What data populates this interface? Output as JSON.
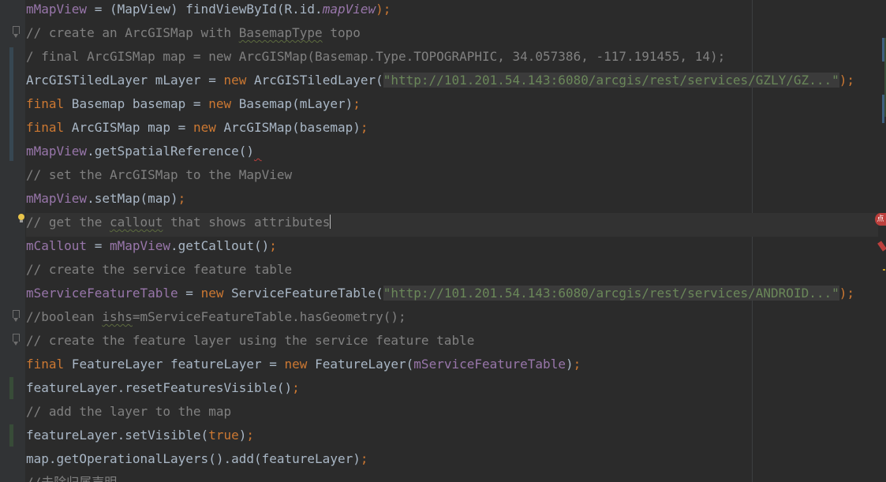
{
  "editor": {
    "lines": [
      {
        "tokens": [
          {
            "t": "mMapView",
            "c": "field"
          },
          {
            "t": " = (MapView) findViewById(R.id.",
            "c": "plain"
          },
          {
            "t": "mapView",
            "c": "italic"
          },
          {
            "t": ");",
            "c": "kw"
          }
        ]
      },
      {
        "tokens": [
          {
            "t": "// create an ArcGISMap with ",
            "c": "comment"
          },
          {
            "t": "BasemapType",
            "c": "comment squig"
          },
          {
            "t": " topo",
            "c": "comment"
          }
        ]
      },
      {
        "tokens": [
          {
            "t": "/ final ArcGISMap map = new ArcGISMap(Basemap.Type.TOPOGRAPHIC, 34.057386, -117.191455, 14);",
            "c": "comment"
          }
        ]
      },
      {
        "tokens": [
          {
            "t": "ArcGISTiledLayer mLayer = ",
            "c": "plain"
          },
          {
            "t": "new",
            "c": "kw"
          },
          {
            "t": " ArcGISTiledLayer(",
            "c": "plain"
          },
          {
            "t": "\"http://101.201.54.143:6080/arcgis/rest/services/GZLY/GZ...\"",
            "c": "fold"
          },
          {
            "t": ");",
            "c": "kw"
          }
        ]
      },
      {
        "tokens": [
          {
            "t": "final",
            "c": "kw"
          },
          {
            "t": " Basemap basemap = ",
            "c": "plain"
          },
          {
            "t": "new",
            "c": "kw"
          },
          {
            "t": " Basemap(mLayer)",
            "c": "plain"
          },
          {
            "t": ";",
            "c": "kw"
          }
        ]
      },
      {
        "tokens": [
          {
            "t": "final",
            "c": "kw"
          },
          {
            "t": " ArcGISMap map = ",
            "c": "plain"
          },
          {
            "t": "new",
            "c": "kw"
          },
          {
            "t": " ArcGISMap(basemap)",
            "c": "plain"
          },
          {
            "t": ";",
            "c": "kw"
          }
        ]
      },
      {
        "tokens": [
          {
            "t": "mMapView",
            "c": "field"
          },
          {
            "t": ".getSpatialReference()",
            "c": "plain"
          },
          {
            "t": " ",
            "c": "plain err"
          }
        ]
      },
      {
        "tokens": [
          {
            "t": "// set the ArcGISMap to the MapView",
            "c": "comment"
          }
        ]
      },
      {
        "tokens": [
          {
            "t": "mMapView",
            "c": "field"
          },
          {
            "t": ".setMap(map)",
            "c": "plain"
          },
          {
            "t": ";",
            "c": "kw"
          }
        ]
      },
      {
        "current": true,
        "tokens": [
          {
            "t": "// get the ",
            "c": "comment"
          },
          {
            "t": "callout",
            "c": "comment squig"
          },
          {
            "t": " that shows attributes",
            "c": "comment"
          }
        ]
      },
      {
        "tokens": [
          {
            "t": "mCallout",
            "c": "field"
          },
          {
            "t": " = ",
            "c": "plain"
          },
          {
            "t": "mMapView",
            "c": "field"
          },
          {
            "t": ".getCallout()",
            "c": "plain"
          },
          {
            "t": ";",
            "c": "kw"
          }
        ]
      },
      {
        "tokens": [
          {
            "t": "// create the service feature table",
            "c": "comment"
          }
        ]
      },
      {
        "tokens": [
          {
            "t": "mServiceFeatureTable",
            "c": "field"
          },
          {
            "t": " = ",
            "c": "plain"
          },
          {
            "t": "new",
            "c": "kw"
          },
          {
            "t": " ServiceFeatureTable(",
            "c": "plain"
          },
          {
            "t": "\"http://101.201.54.143:6080/arcgis/rest/services/ANDROID...\"",
            "c": "fold"
          },
          {
            "t": ");",
            "c": "kw"
          }
        ]
      },
      {
        "tokens": [
          {
            "t": "//boolean ",
            "c": "comment"
          },
          {
            "t": "ishs",
            "c": "comment squig"
          },
          {
            "t": "=mServiceFeatureTable.hasGeometry();",
            "c": "comment"
          }
        ]
      },
      {
        "tokens": [
          {
            "t": "// create the feature layer using the service feature table",
            "c": "comment"
          }
        ]
      },
      {
        "tokens": [
          {
            "t": "final",
            "c": "kw"
          },
          {
            "t": " FeatureLayer featureLayer = ",
            "c": "plain"
          },
          {
            "t": "new",
            "c": "kw"
          },
          {
            "t": " FeatureLayer(",
            "c": "plain"
          },
          {
            "t": "mServiceFeatureTable",
            "c": "field"
          },
          {
            "t": ")",
            "c": "plain"
          },
          {
            "t": ";",
            "c": "kw"
          }
        ]
      },
      {
        "tokens": [
          {
            "t": "featureLayer.resetFeaturesVisible()",
            "c": "plain"
          },
          {
            "t": ";",
            "c": "kw"
          }
        ]
      },
      {
        "tokens": [
          {
            "t": "// add the layer to the map",
            "c": "comment"
          }
        ]
      },
      {
        "tokens": [
          {
            "t": "featureLayer.setVisible(",
            "c": "plain"
          },
          {
            "t": "true",
            "c": "bool"
          },
          {
            "t": ")",
            "c": "plain"
          },
          {
            "t": ";",
            "c": "kw"
          }
        ]
      },
      {
        "tokens": [
          {
            "t": "map.getOperationalLayers().add(featureLayer)",
            "c": "plain"
          },
          {
            "t": ";",
            "c": "kw"
          }
        ]
      },
      {
        "tokens": [
          {
            "t": "//去除归属声明",
            "c": "comment"
          }
        ]
      }
    ]
  },
  "colors": {
    "background": "#2b2b2b",
    "gutter": "#313335",
    "keyword": "#cc7832",
    "field": "#9876aa",
    "comment": "#808080",
    "string": "#6a8759",
    "text": "#a9b7c6"
  },
  "icons": {
    "fold": "fold-icon",
    "intention": "lightbulb-icon",
    "error": "error-badge-icon"
  },
  "error_badge": "点"
}
